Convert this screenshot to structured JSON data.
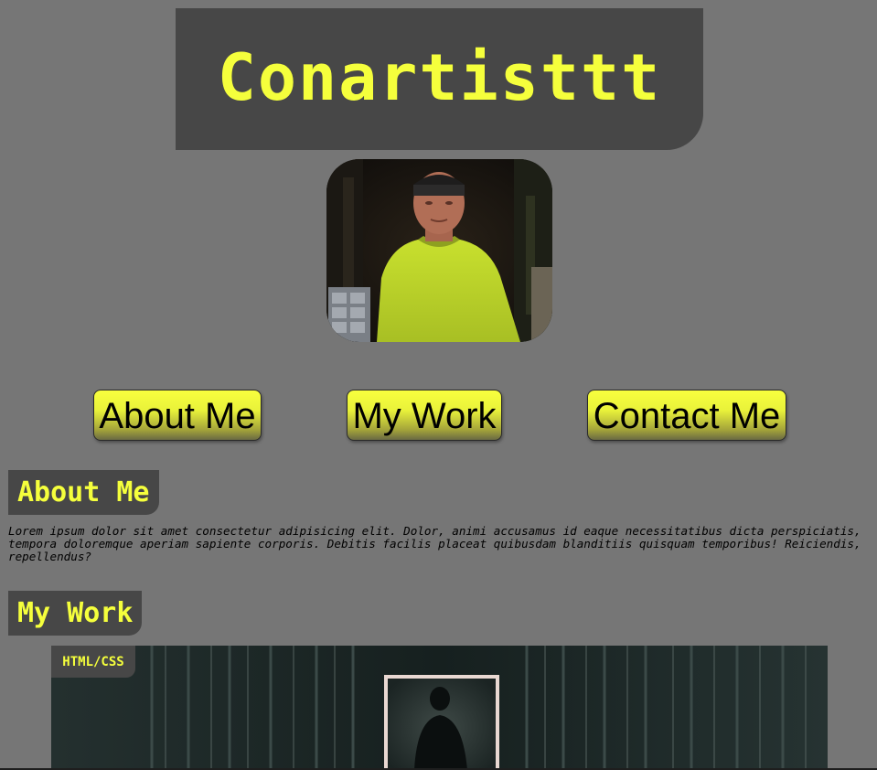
{
  "header": {
    "title": "Conartisttt"
  },
  "nav": {
    "items": [
      {
        "label": "About Me"
      },
      {
        "label": "My Work"
      },
      {
        "label": "Contact Me"
      }
    ]
  },
  "about": {
    "heading": "About Me",
    "body": "Lorem ipsum dolor sit amet consectetur adipisicing elit. Dolor, animi accusamus id eaque necessitatibus dicta perspiciatis, tempora doloremque aperiam sapiente corporis. Debitis facilis placeat quibusdam blanditiis quisquam temporibus! Reiciendis, repellendus?"
  },
  "work": {
    "heading": "My Work",
    "projects": [
      {
        "label": "HTML/CSS"
      }
    ]
  },
  "colors": {
    "background": "#767676",
    "panel": "#474747",
    "accent": "#f5ff3c"
  }
}
